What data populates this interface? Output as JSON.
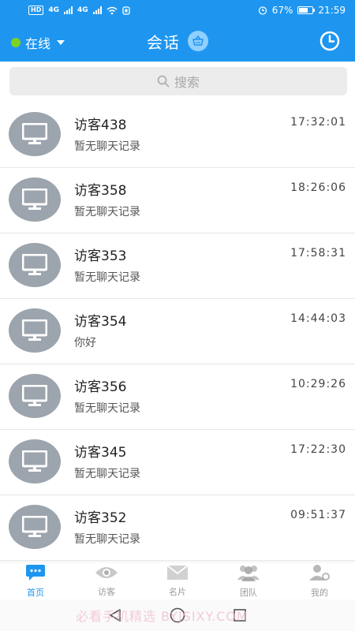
{
  "status_bar": {
    "network_badge": "HD",
    "signal_1": "4G",
    "signal_2": "4G",
    "battery_percent": "67%",
    "time": "21:59"
  },
  "header": {
    "online_label": "在线",
    "title": "会话",
    "icons": [
      "online-dot",
      "caret-down-icon",
      "basket-icon",
      "clock-icon"
    ]
  },
  "search": {
    "placeholder": "搜索"
  },
  "conversations": [
    {
      "name": "访客438",
      "preview": "暂无聊天记录",
      "time": "17:32:01"
    },
    {
      "name": "访客358",
      "preview": "暂无聊天记录",
      "time": "18:26:06"
    },
    {
      "name": "访客353",
      "preview": "暂无聊天记录",
      "time": "17:58:31"
    },
    {
      "name": "访客354",
      "preview": "你好",
      "time": "14:44:03"
    },
    {
      "name": "访客356",
      "preview": "暂无聊天记录",
      "time": "10:29:26"
    },
    {
      "name": "访客345",
      "preview": "暂无聊天记录",
      "time": "17:22:30"
    },
    {
      "name": "访客352",
      "preview": "暂无聊天记录",
      "time": "09:51:37"
    }
  ],
  "bottom_nav": [
    {
      "label": "首页",
      "icon": "chat-icon",
      "active": true
    },
    {
      "label": "访客",
      "icon": "eye-icon",
      "active": false
    },
    {
      "label": "名片",
      "icon": "envelope-icon",
      "active": false
    },
    {
      "label": "团队",
      "icon": "team-icon",
      "active": false
    },
    {
      "label": "我的",
      "icon": "user-gear-icon",
      "active": false
    }
  ],
  "watermark": "必看手机精选 BYJSIXY.COM",
  "colors": {
    "primary": "#1e96f0",
    "online": "#7ed321",
    "avatar": "#9ca4ad"
  }
}
